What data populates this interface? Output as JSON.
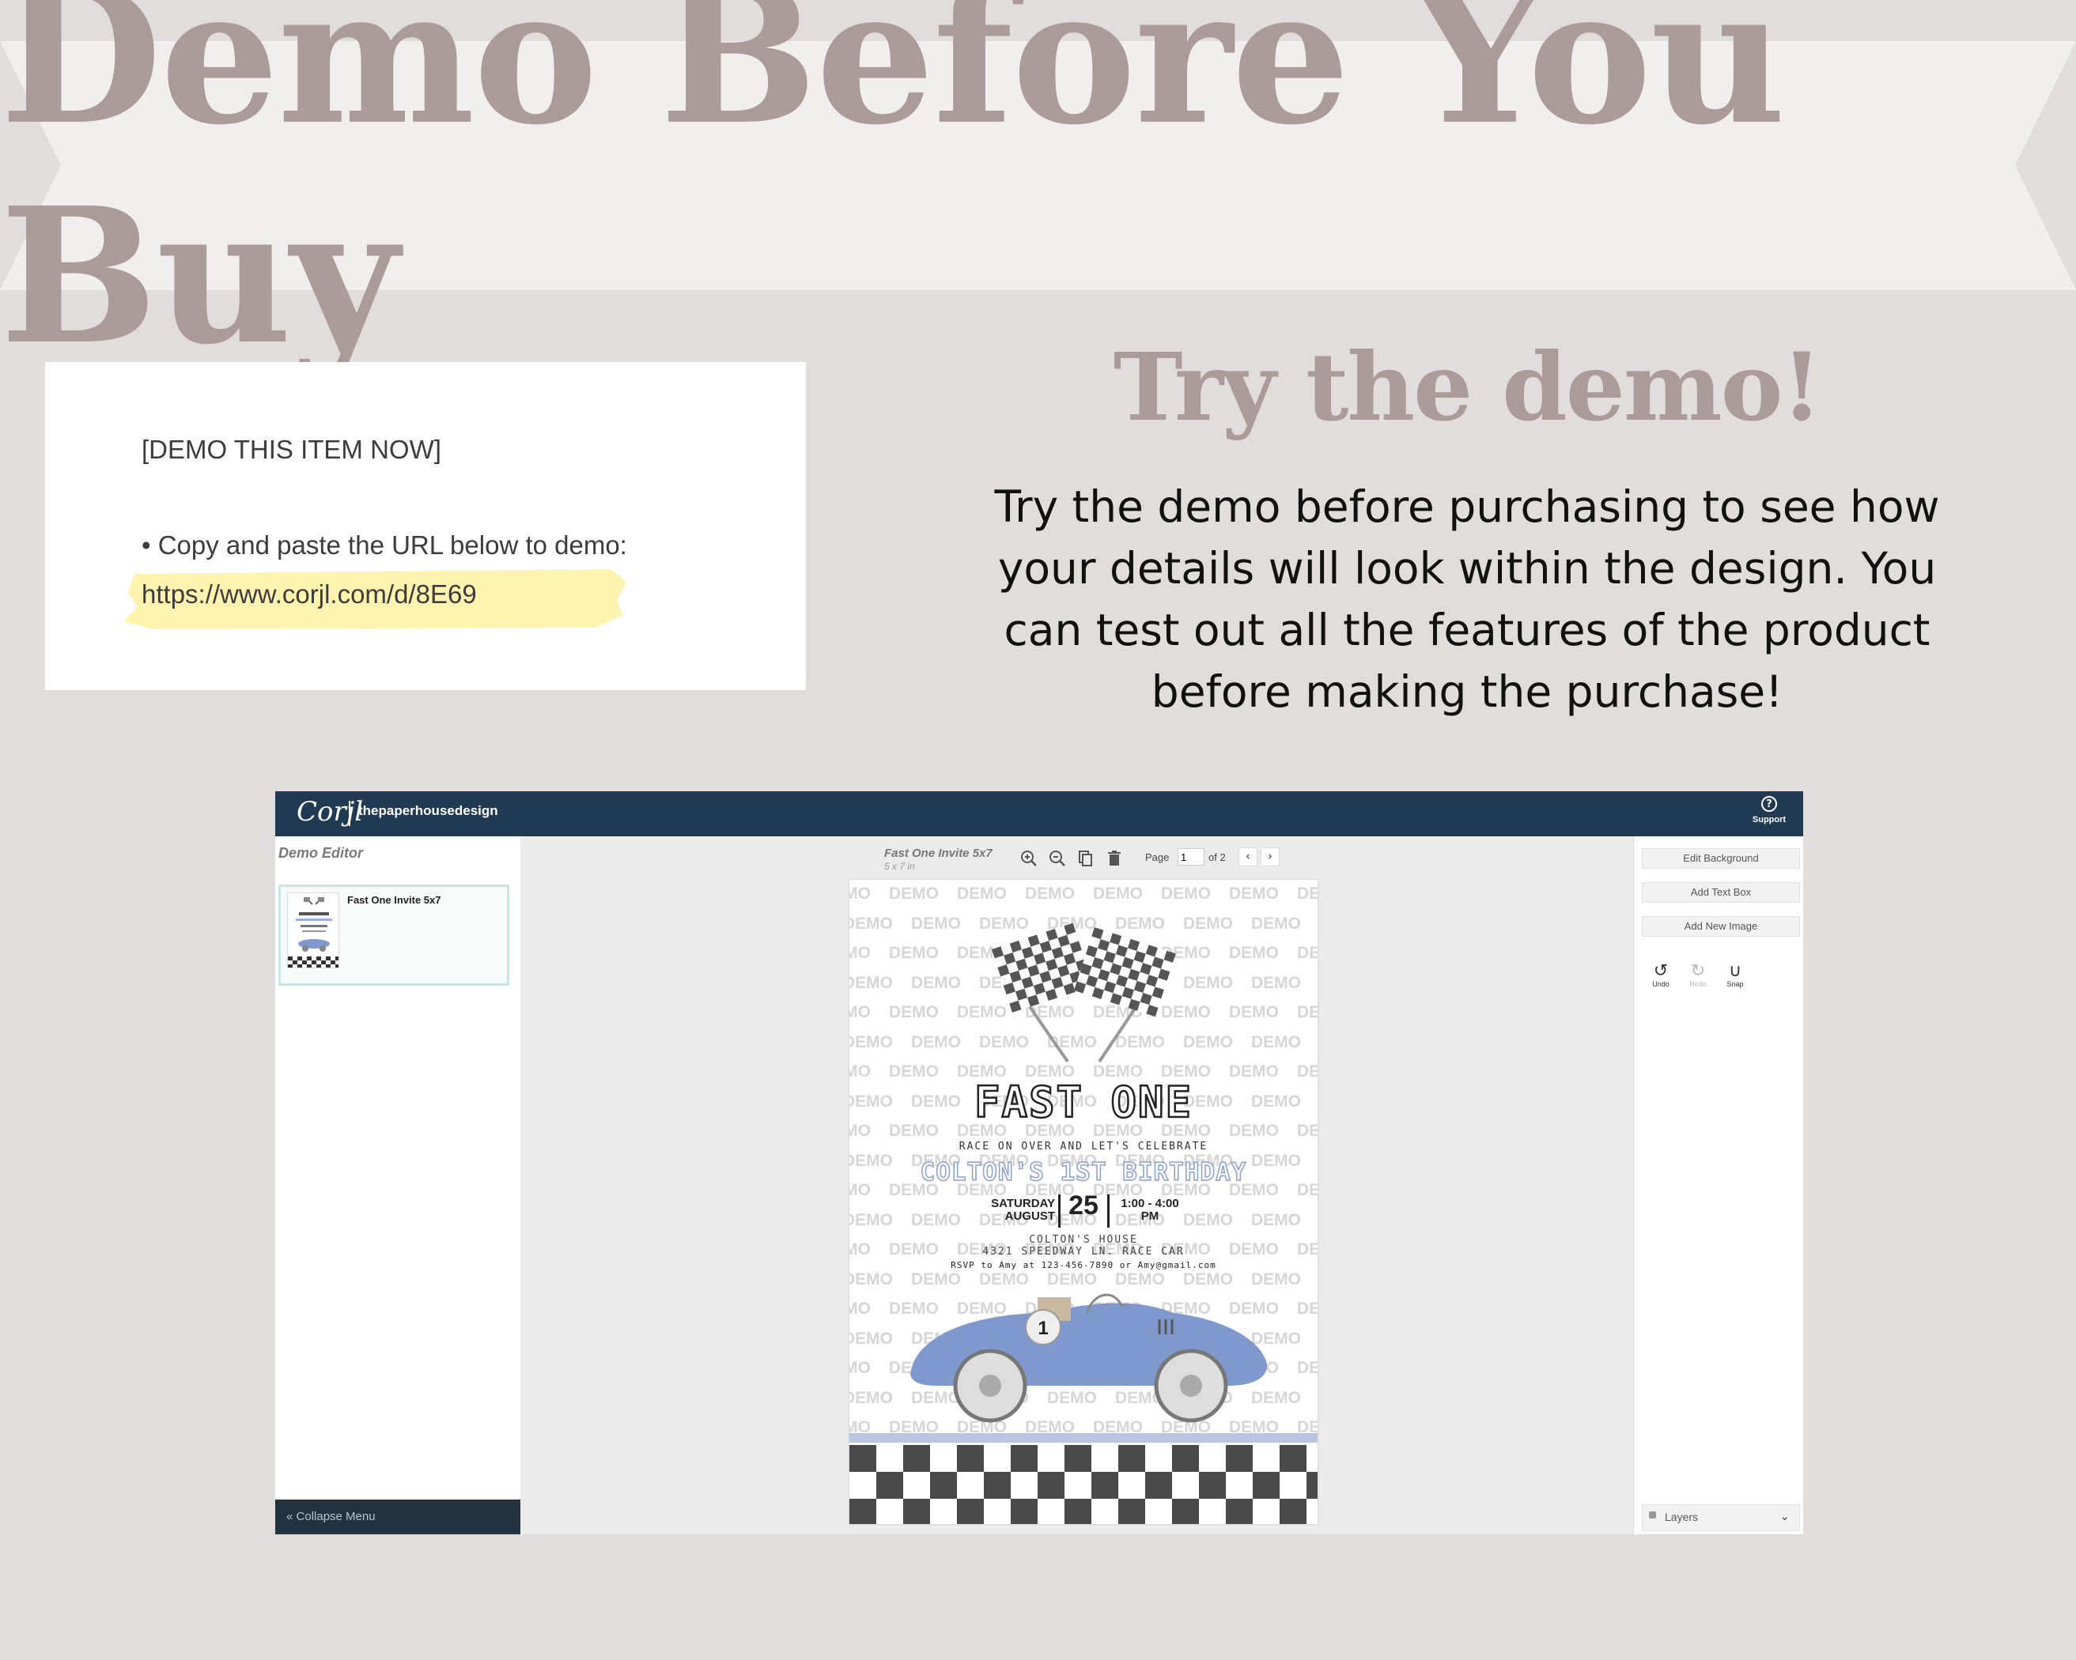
{
  "banner": {
    "title": "Demo Before You Buy"
  },
  "demo_card": {
    "header": "[DEMO THIS ITEM NOW]",
    "instruction": "• Copy and paste the URL below to demo:",
    "url": "https://www.corjl.com/d/8E69"
  },
  "try_section": {
    "title": "Try the demo!",
    "body": "Try the demo before purchasing to see how your details will look within the design. You can test out all the features of the product before making the purchase!"
  },
  "editor": {
    "logo": "Corjl",
    "shop_name": "thepaperhousedesign",
    "support_label": "Support",
    "left_panel": {
      "title": "Demo Editor",
      "items": [
        {
          "name": "Fast One Invite 5x7"
        }
      ],
      "collapse_label": "Collapse Menu"
    },
    "toolbar": {
      "doc_name": "Fast One Invite 5x7",
      "doc_size": "5 x 7 in",
      "page_label": "Page",
      "page_value": "1",
      "page_total": "of 2",
      "icons": [
        "zoom-in-icon",
        "zoom-out-icon",
        "duplicate-icon",
        "trash-icon"
      ]
    },
    "right_panel": {
      "buttons": [
        "Edit Background",
        "Add Text Box",
        "Add New Image"
      ],
      "undo_label": "Undo",
      "redo_label": "Redo",
      "snap_label": "Snap",
      "layers_label": "Layers"
    },
    "invite": {
      "watermark": "DEMO",
      "title": "FAST ONE",
      "subtitle": "RACE ON OVER AND LET'S CELEBRATE",
      "name": "COLTON'S 1ST BIRTHDAY",
      "day_name": "SATURDAY",
      "month": "AUGUST",
      "day": "25",
      "time": "1:00 - 4:00",
      "ampm": "PM",
      "place": "COLTON'S HOUSE",
      "address": "4321 SPEEDWAY LN. RACE CAR",
      "rsvp": "RSVP to Amy at 123-456-7890 or Amy@gmail.com",
      "car_number": "1"
    }
  },
  "colors": {
    "background": "#e2dddd",
    "banner": "#f1efee",
    "title_accent": "#ab9b99",
    "topbar": "#1f3a52",
    "highlight": "#fff3b0",
    "car_blue": "#7f99cf"
  }
}
